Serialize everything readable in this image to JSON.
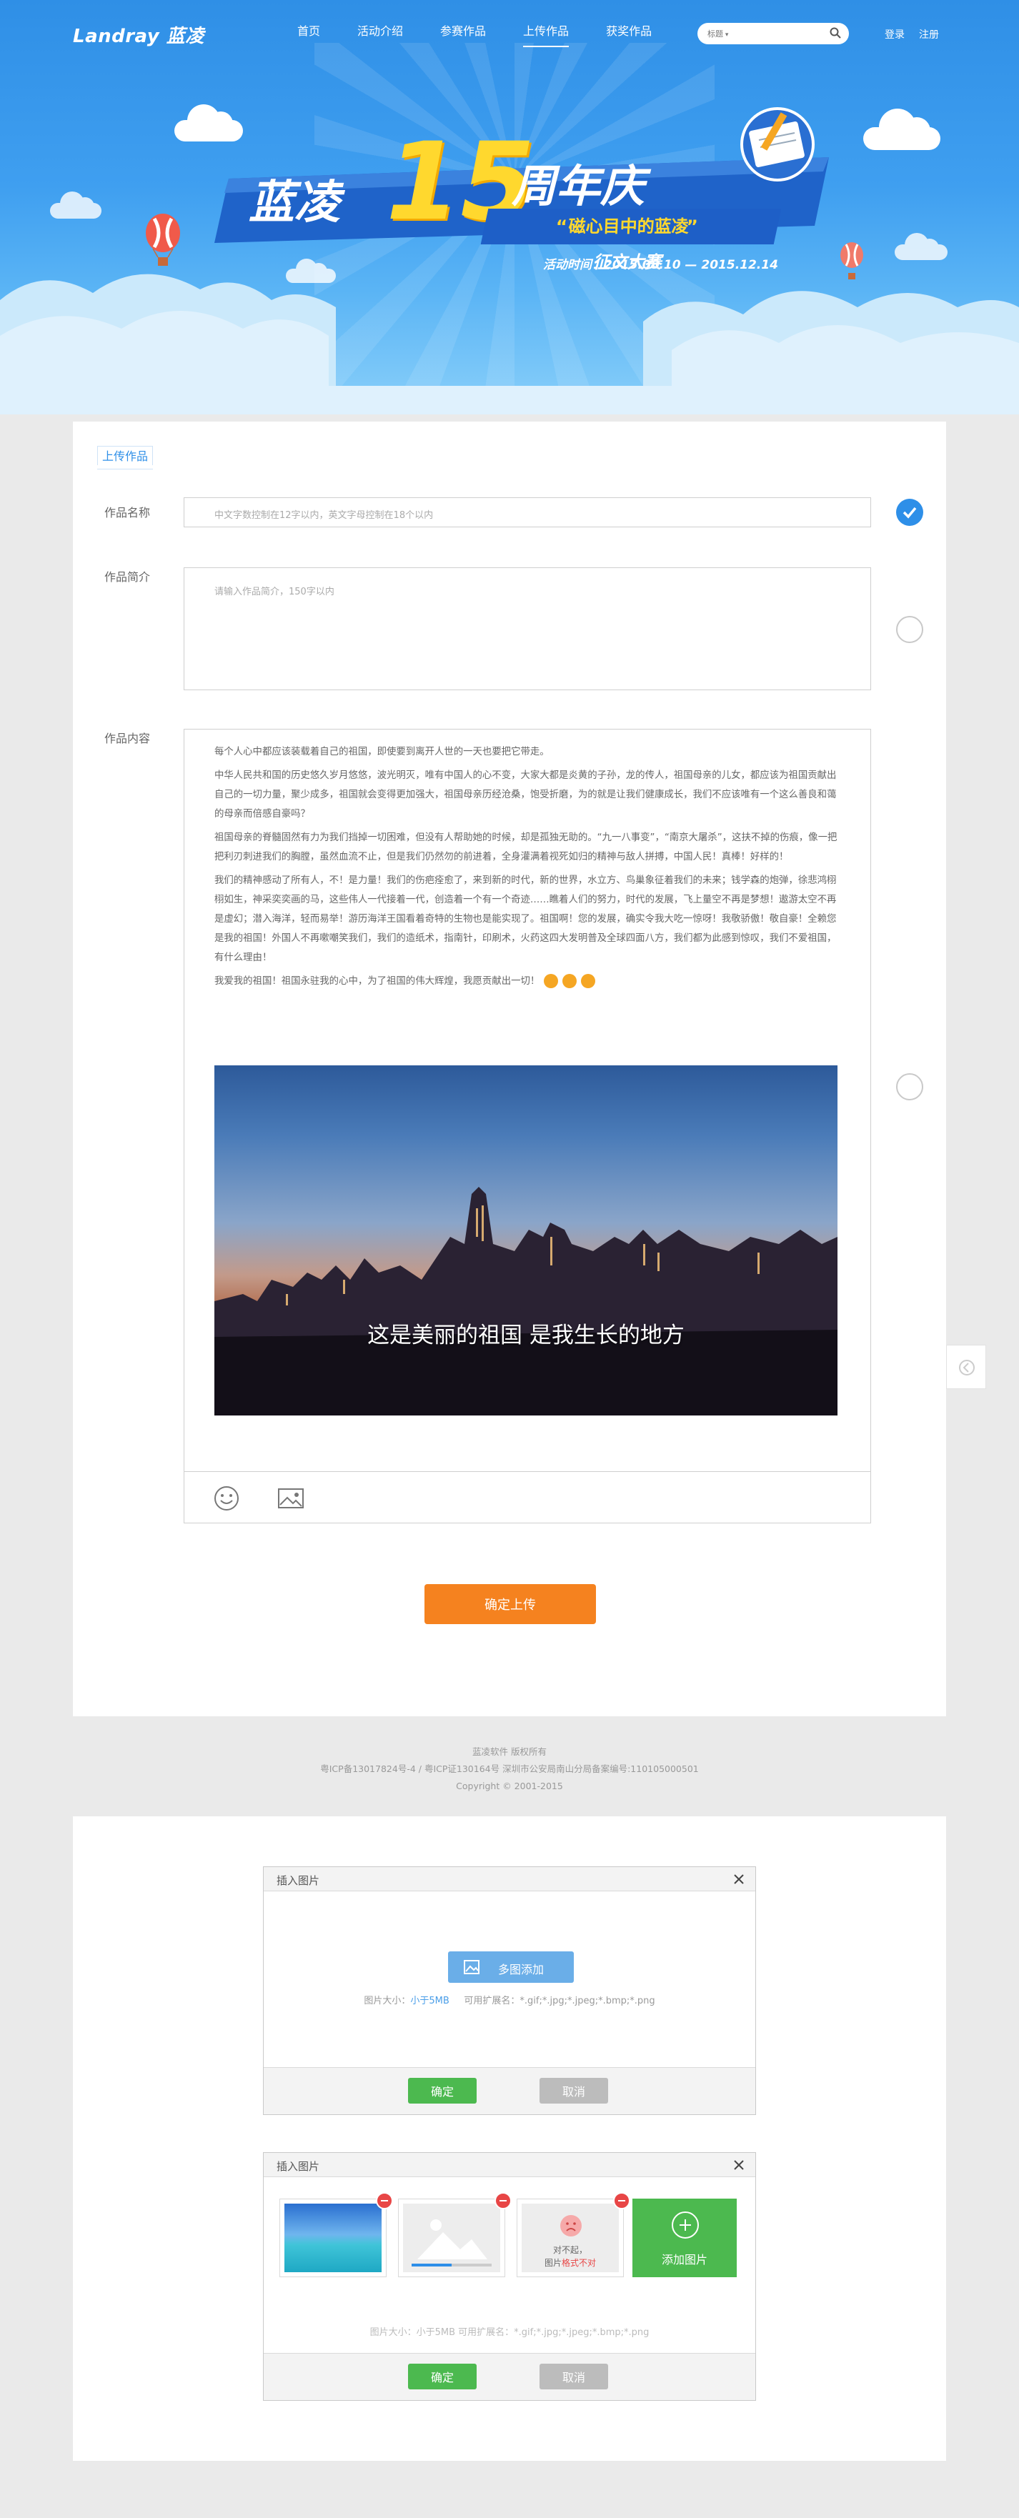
{
  "header": {
    "logo": "Landray 蓝凌",
    "nav": [
      "首页",
      "活动介绍",
      "参赛作品",
      "上传作品",
      "获奖作品"
    ],
    "active_nav_index": 3,
    "search": {
      "category": "标题",
      "placeholder": ""
    },
    "auth": {
      "login": "登录",
      "register": "注册"
    }
  },
  "banner": {
    "title_left": "蓝凌",
    "number": "15",
    "title_right": "周年庆",
    "subtitle_quote": "“磁心目中的蓝凌”",
    "subtitle_suffix": "征文大赛",
    "date_label": "活动时间：",
    "date_value": "2015.08.10 — 2015.12.14"
  },
  "form": {
    "tab_label": "上传作品",
    "name": {
      "label": "作品名称",
      "placeholder": "中文字数控制在12字以内，英文字母控制在18个以内",
      "valid": true
    },
    "desc": {
      "label": "作品简介",
      "placeholder": "请输入作品简介，150字以内",
      "valid": false
    },
    "content": {
      "label": "作品内容",
      "paragraphs": [
        "每个人心中都应该装载着自己的祖国，即使要到离开人世的一天也要把它带走。",
        "中华人民共和国的历史悠久岁月悠悠，波光明灭，唯有中国人的心不变，大家大都是炎黄的子孙，龙的传人，祖国母亲的儿女，都应该为祖国贡献出自己的一切力量，聚少成多，祖国就会变得更加强大，祖国母亲历经沧桑，饱受折磨，为的就是让我们健康成长，我们不应该唯有一个这么善良和蔼的母亲而倍感自豪吗？",
        "祖国母亲的脊髓固然有力为我们挡掉一切困难，但没有人帮助她的时候，却是孤独无助的。“九一八事变”，“南京大屠杀”，这扶不掉的伤痕，像一把把利刃刺进我们的胸膛，虽然血流不止，但是我们仍然勿的前进着，全身灌满着视死如归的精神与敌人拼搏，中国人民！真棒！好样的！",
        "我们的精神感动了所有人，不！是力量！我们的伤疤痊愈了，来到新的时代，新的世界，水立方、鸟巢象征着我们的未来；钱学森的炮弹，徐悲鸿栩栩如生，神采奕奕画的马，这些伟人一代接着一代，创造着一个有一个奇迹……瞧着人们的努力，时代的发展，飞上量空不再是梦想！遨游太空不再是虚幻；潜入海洋，轻而易举！游历海洋王国看着奇特的生物也是能实现了。祖国啊！您的发展，确实令我大吃一惊呀！我敬骄傲！敬自豪！全赖您是我的祖国！外国人不再嗽嘲笑我们，我们的造纸术，指南针，印刷术，火药这四大发明普及全球四面八方，我们都为此感到惊叹，我们不爱祖国，有什么理由！",
        "我爱我的祖国！祖国永驻我的心中，为了祖国的伟大辉煌，我愿贡献出一切！"
      ],
      "image_caption": "这是美丽的祖国 是我生长的地方",
      "valid": false
    },
    "submit_label": "确定上传"
  },
  "footer": {
    "line1": "蓝凌软件  版权所有",
    "line2": "粤ICP备13017824号-4 / 粤ICP证130164号    深圳市公安局南山分局备案编号:110105000501",
    "line3": "Copyright © 2001-2015"
  },
  "dialog1": {
    "title": "插入图片",
    "multi_add_label": "多图添加",
    "hint_size_label": "图片大小：",
    "hint_size_value": "小于5MB",
    "hint_ext": "可用扩展名：*.gif;*.jpg;*.jpeg;*.bmp;*.png",
    "ok_label": "确定",
    "cancel_label": "取消"
  },
  "dialog2": {
    "title": "插入图片",
    "error_line1": "对不起，",
    "error_line2_prefix": "图片",
    "error_line2_red": "格式不对",
    "add_label": "添加图片",
    "hint": "图片大小：小于5MB    可用扩展名：*.gif;*.jpg;*.jpeg;*.bmp;*.png",
    "ok_label": "确定",
    "cancel_label": "取消",
    "upload_progress": 0.5
  },
  "colors": {
    "primary": "#2e8fe8",
    "submit": "#f5821f",
    "ok": "#4cb94f",
    "cancel": "#bcbcbc",
    "error": "#e84646"
  },
  "icons": [
    "search-icon",
    "check-icon",
    "emoji-icon",
    "image-icon",
    "close-icon",
    "plus-icon",
    "delete-icon",
    "sad-face-icon",
    "scroll-top-icon"
  ]
}
